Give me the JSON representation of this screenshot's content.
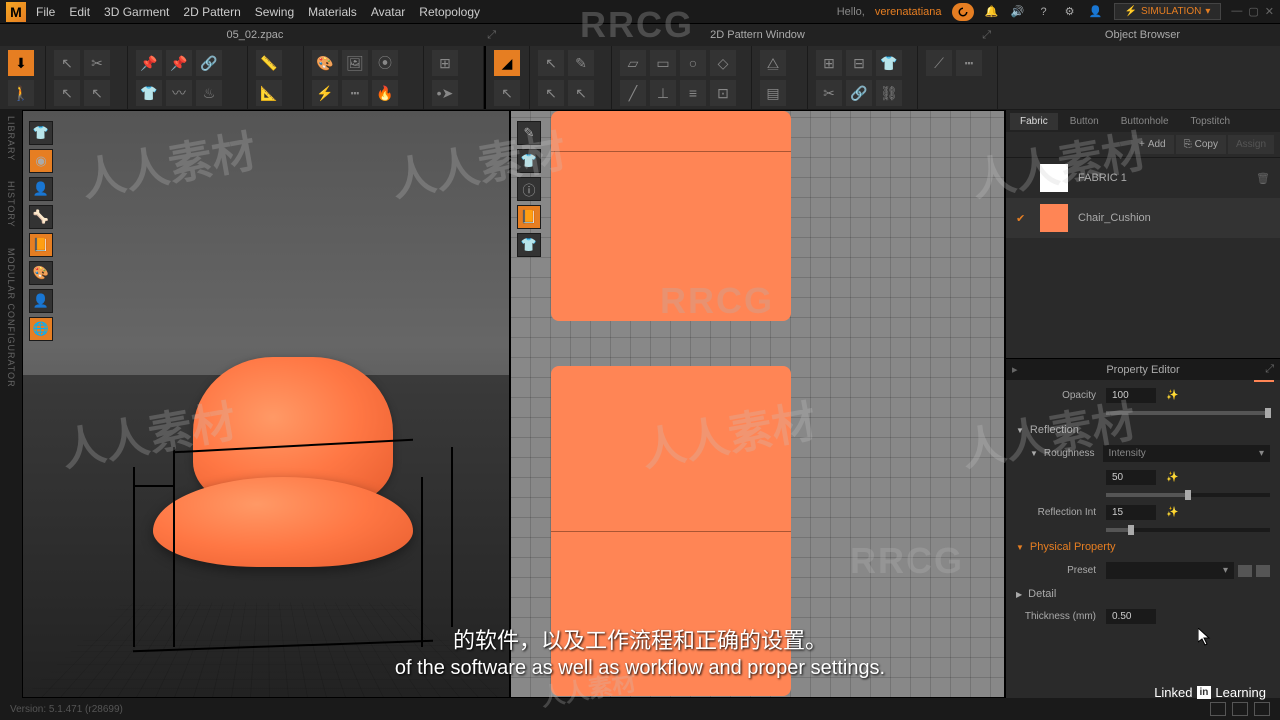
{
  "menu": {
    "file": "File",
    "edit": "Edit",
    "garment3d": "3D Garment",
    "pattern2d": "2D Pattern",
    "sewing": "Sewing",
    "materials": "Materials",
    "avatar": "Avatar",
    "retopology": "Retopology"
  },
  "topbar": {
    "hello": "Hello,",
    "user": "verenatatiana",
    "simulation": "SIMULATION"
  },
  "tabs": {
    "file": "05_02.zpac",
    "pattern_window": "2D Pattern Window",
    "object_browser": "Object Browser"
  },
  "side": {
    "library": "LIBRARY",
    "history": "HISTORY",
    "modular": "MODULAR CONFIGURATOR"
  },
  "obj_tabs": {
    "fabric": "Fabric",
    "button": "Button",
    "buttonhole": "Buttonhole",
    "topstitch": "Topstitch"
  },
  "obj_actions": {
    "add": "Add",
    "copy": "Copy",
    "assign": "Assign"
  },
  "fabrics": {
    "f1": "FABRIC 1",
    "f2": "Chair_Cushion"
  },
  "prop": {
    "header": "Property Editor",
    "opacity_label": "Opacity",
    "opacity_val": "100",
    "reflection": "Reflection",
    "roughness": "Roughness",
    "intensity": "Intensity",
    "roughness_val": "50",
    "reflection_int": "Reflection Int",
    "reflection_int_val": "15",
    "physical": "Physical Property",
    "preset": "Preset",
    "detail": "Detail",
    "thickness": "Thickness (mm)",
    "thickness_val": "0.50"
  },
  "status": {
    "version": "Version: 5.1.471 (r28699)"
  },
  "subtitle": {
    "cn": "的软件，以及工作流程和正确的设置。",
    "en": "of the software as well as workflow and proper settings."
  },
  "branding": {
    "linkedin": "Linked",
    "in": "in",
    "learning": "Learning"
  },
  "watermarks": {
    "rrcg": "RRCG",
    "rrst": "人人素材"
  }
}
